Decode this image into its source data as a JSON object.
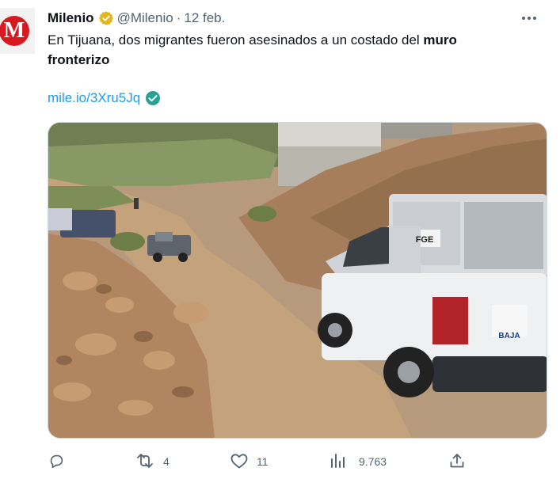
{
  "tweet": {
    "author_name": "Milenio",
    "handle": "@Milenio",
    "separator": "·",
    "date": "12 feb.",
    "avatar_letter": "M",
    "text_plain": "En Tijuana, dos migrantes fueron asesinados a un costado del ",
    "text_bold": "muro fronterizo",
    "link": "mile.io/3Xru5Jq",
    "media_labels": {
      "van_badge": "FGE",
      "tailgate": "BAJA"
    }
  },
  "actions": {
    "reply_count": "",
    "retweet_count": "4",
    "like_count": "11",
    "views_count": "9.763"
  },
  "colors": {
    "brand_red": "#d71920",
    "verified_gold": "#e2b719",
    "link_blue": "#1d9bf0",
    "link_check_green": "#2aa197",
    "muted": "#536471"
  },
  "icons": [
    "more-icon",
    "verified-badge-icon",
    "link-check-icon",
    "reply-icon",
    "retweet-icon",
    "like-icon",
    "views-icon",
    "share-icon"
  ]
}
